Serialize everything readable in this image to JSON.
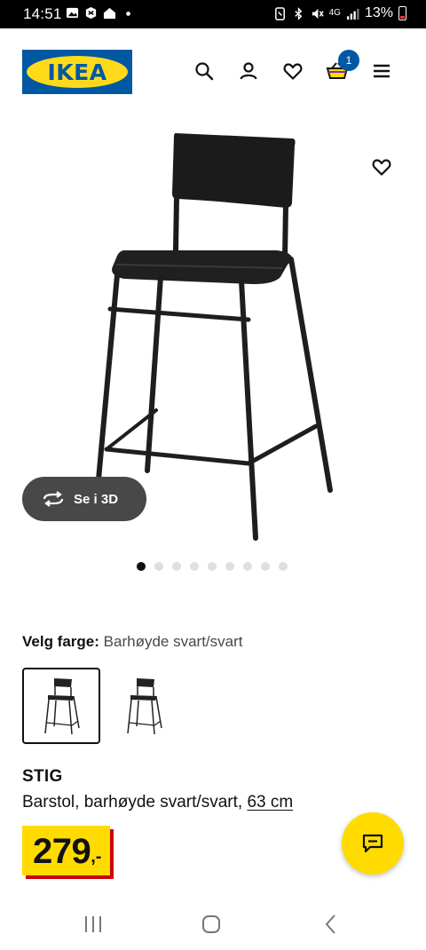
{
  "status_bar": {
    "time": "14:51",
    "network": "4G",
    "battery": "13%"
  },
  "header": {
    "logo_text": "IKEA",
    "cart_count": "1",
    "icons": [
      "search-icon",
      "profile-icon",
      "heart-icon",
      "cart-icon",
      "menu-icon"
    ]
  },
  "product": {
    "view_3d_label": "Se i 3D",
    "image_count": 9,
    "active_image": 0,
    "color_prefix": "Velg farge:",
    "color_value": "Barhøyde svart/svart",
    "name": "STIG",
    "description": "Barstol, barhøyde svart/svart,",
    "size_link": "63 cm",
    "price_integer": "279",
    "price_suffix": ",-"
  },
  "colors": {
    "brand_blue": "#0058a3",
    "brand_yellow": "#ffdb00",
    "price_shadow": "#cc0008"
  }
}
